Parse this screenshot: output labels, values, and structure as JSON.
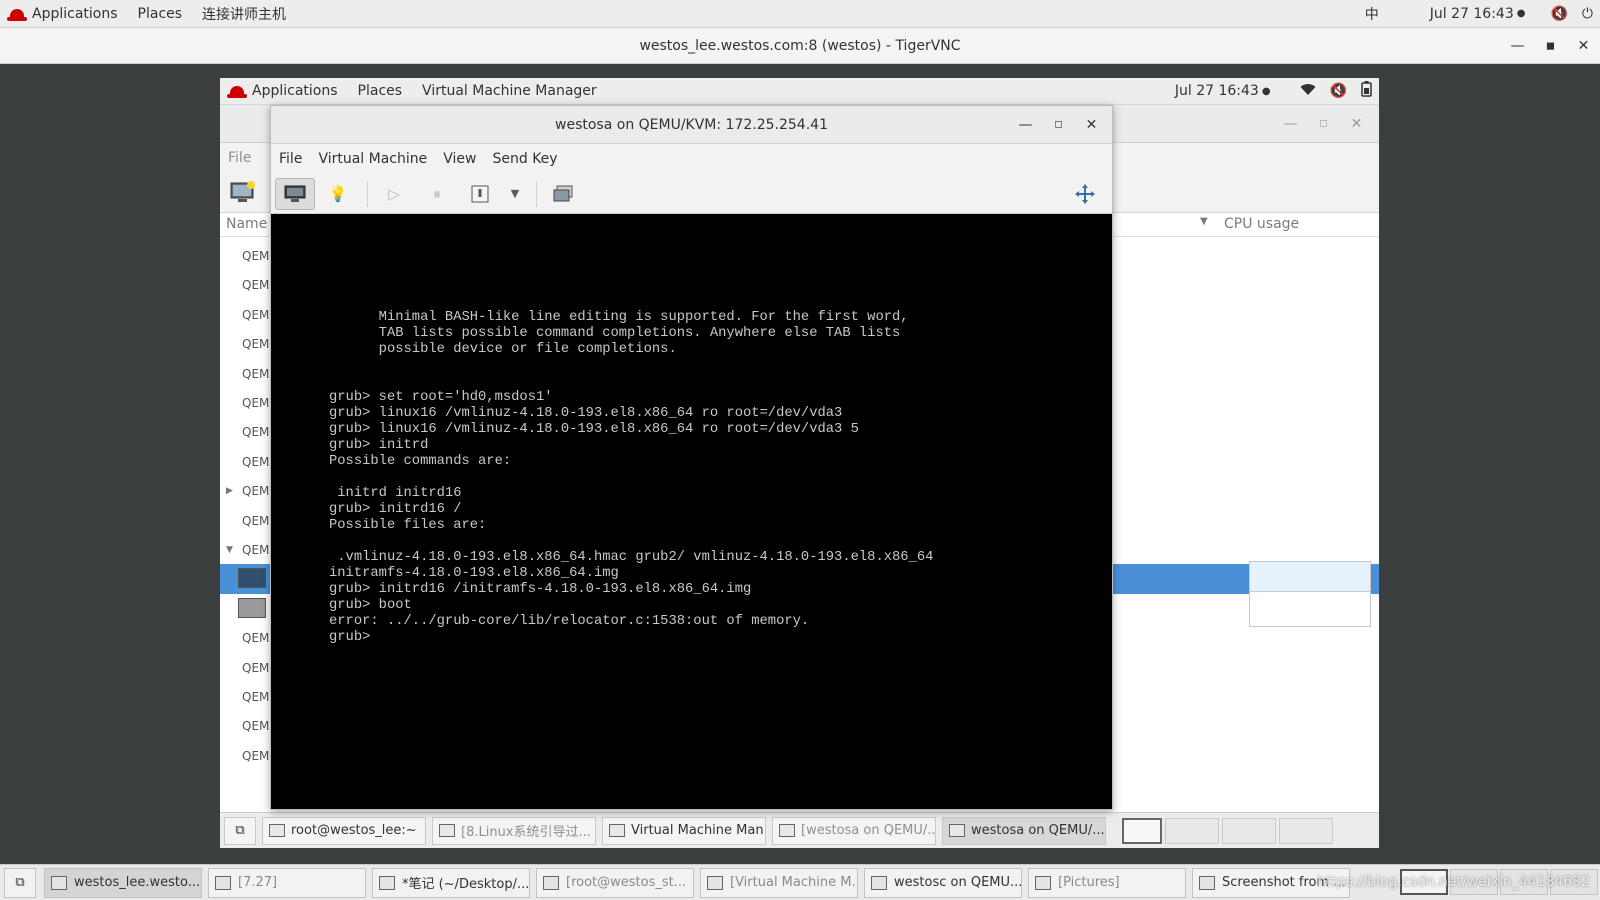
{
  "host_topbar": {
    "applications": "Applications",
    "places": "Places",
    "connect_label": "连接讲师主机",
    "input_method": "中",
    "datetime": "Jul 27  16:43"
  },
  "host_window": {
    "title": "westos_lee.westos.com:8 (westos) - TigerVNC"
  },
  "vnc_topbar": {
    "applications": "Applications",
    "places": "Places",
    "vmm_menu": "Virtual Machine Manager",
    "datetime": "Jul 27  16:43"
  },
  "vmm": {
    "menu_file": "File",
    "col_name": "Name",
    "col_cpu": "CPU usage",
    "rows": [
      "QEMU",
      "QEMU",
      "QEMU",
      "QEMU",
      "QEMU",
      "QEMU",
      "QEMU",
      "QEMU",
      "QEMU",
      "QEMU",
      "QEMU",
      "",
      "",
      "QEMU",
      "QEMU",
      "QEMU",
      "QEMU",
      "QEMU"
    ]
  },
  "viewer": {
    "title": "westosa on QEMU/KVM: 172.25.254.41",
    "menu": [
      "File",
      "Virtual Machine",
      "View",
      "Send Key"
    ]
  },
  "console_lines": [
    "      Minimal BASH-like line editing is supported. For the first word,",
    "      TAB lists possible command completions. Anywhere else TAB lists",
    "      possible device or file completions.",
    "",
    "",
    "grub> set root='hd0,msdos1'",
    "grub> linux16 /vmlinuz-4.18.0-193.el8.x86_64 ro root=/dev/vda3",
    "grub> linux16 /vmlinuz-4.18.0-193.el8.x86_64 ro root=/dev/vda3 5",
    "grub> initrd",
    "Possible commands are:",
    "",
    " initrd initrd16",
    "grub> initrd16 /",
    "Possible files are:",
    "",
    " .vmlinuz-4.18.0-193.el8.x86_64.hmac grub2/ vmlinuz-4.18.0-193.el8.x86_64",
    "initramfs-4.18.0-193.el8.x86_64.img",
    "grub> initrd16 /initramfs-4.18.0-193.el8.x86_64.img",
    "grub> boot",
    "error: ../../grub-core/lib/relocator.c:1538:out of memory.",
    "grub>"
  ],
  "vnc_taskbar": [
    {
      "label": "root@westos_lee:~",
      "state": "normal"
    },
    {
      "label": "[8.Linux系统引导过...",
      "state": "dim"
    },
    {
      "label": "Virtual Machine Man...",
      "state": "normal"
    },
    {
      "label": "[westosa on QEMU/...",
      "state": "dim"
    },
    {
      "label": "westosa on QEMU/...",
      "state": "active"
    }
  ],
  "host_taskbar": [
    {
      "label": "westos_lee.westo...",
      "state": "active"
    },
    {
      "label": "[7.27]",
      "state": "dim"
    },
    {
      "label": "*笔记 (~/Desktop/...",
      "state": "normal"
    },
    {
      "label": "[root@westos_st...",
      "state": "dim"
    },
    {
      "label": "[Virtual Machine M...",
      "state": "dim"
    },
    {
      "label": "westosc on QEMU...",
      "state": "normal"
    },
    {
      "label": "[Pictures]",
      "state": "dim"
    },
    {
      "label": "Screenshot from ...",
      "state": "normal"
    }
  ],
  "watermark": "https://blog.csdn.net/weixin_44184682",
  "colors": {
    "selection": "#4a90d9",
    "console_bg": "#000000",
    "console_fg": "#c8c8c8",
    "redhat": "#cc0000"
  }
}
